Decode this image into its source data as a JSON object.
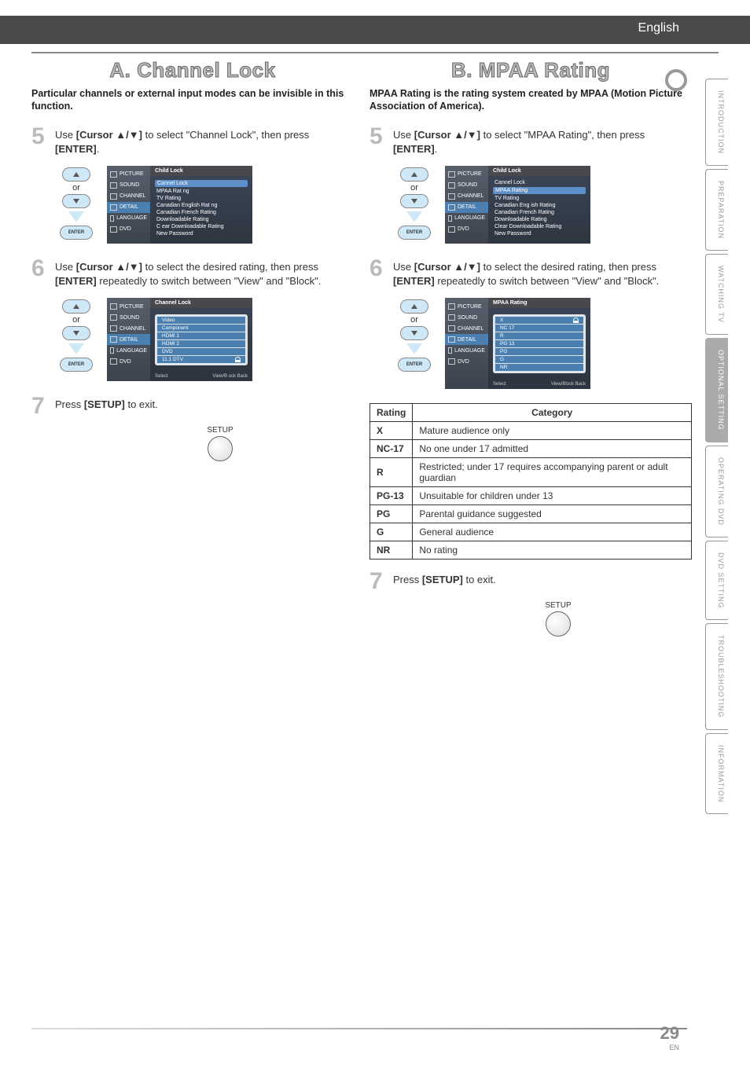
{
  "header": {
    "language": "English"
  },
  "side_tabs": [
    "INTRODUCTION",
    "PREPARATION",
    "WATCHING TV",
    "OPTIONAL SETTING",
    "OPERATING DVD",
    "DVD SETTING",
    "TROUBLESHOOTING",
    "INFORMATION"
  ],
  "side_tabs_active": 3,
  "page": {
    "number": "29",
    "en": "EN"
  },
  "left": {
    "title": "A.   Channel Lock",
    "subtitle": "Particular channels or external input modes can be invisible in this function.",
    "step5": {
      "num": "5",
      "text_a": "Use ",
      "cursor": "[Cursor ▲/▼]",
      "text_b": " to select \"Channel Lock\", then press ",
      "enter": "[ENTER]",
      "text_c": "."
    },
    "step6": {
      "num": "6",
      "text_a": "Use ",
      "cursor": "[Cursor ▲/▼]",
      "text_b": " to select the desired rating, then press ",
      "enter": "[ENTER]",
      "text_c": " repeatedly to switch between \"View\" and \"Block\"."
    },
    "step7": {
      "num": "7",
      "text_a": "Press ",
      "setup": "[SETUP]",
      "text_b": " to exit."
    },
    "remote": {
      "or": "or",
      "enter": "ENTER",
      "setup": "SETUP"
    },
    "osd1": {
      "title": "Child Lock",
      "side": [
        "PICTURE",
        "SOUND",
        "CHANNEL",
        "DETAIL",
        "LANGUAGE",
        "DVD"
      ],
      "items": [
        "Cannel Lock",
        "MPAA Rat ng",
        "TV Rating",
        "Canadian English Rat ng",
        "Canadian French Rating",
        "Downloadable Rating",
        "C ear Downloadable Rating",
        "New Password"
      ],
      "sel": 0
    },
    "osd2": {
      "title": "Channel Lock",
      "side": [
        "PICTURE",
        "SOUND",
        "CHANNEL",
        "DETAIL",
        "LANGUAGE",
        "DVD"
      ],
      "inner": [
        "Video",
        "Component",
        "HDMI 1",
        "HDMI 2",
        "DVD",
        "11.1 DTV"
      ],
      "footer_l": "Select",
      "footer_r": "View/B ock     Back"
    }
  },
  "right": {
    "title": "B. MPAA Rating",
    "subtitle": "MPAA Rating is the rating system created by MPAA (Motion Picture Association of America).",
    "step5": {
      "num": "5",
      "text_a": "Use ",
      "cursor": "[Cursor ▲/▼]",
      "text_b": " to select \"MPAA Rating\", then press ",
      "enter": "[ENTER]",
      "text_c": "."
    },
    "step6": {
      "num": "6",
      "text_a": "Use ",
      "cursor": "[Cursor ▲/▼]",
      "text_b": " to select the desired rating, then press ",
      "enter": "[ENTER]",
      "text_c": " repeatedly to switch between \"View\" and \"Block\"."
    },
    "step7": {
      "num": "7",
      "text_a": "Press ",
      "setup": "[SETUP]",
      "text_b": " to exit."
    },
    "remote": {
      "or": "or",
      "enter": "ENTER",
      "setup": "SETUP"
    },
    "osd1": {
      "title": "Child Lock",
      "side": [
        "PICTURE",
        "SOUND",
        "CHANNEL",
        "DETAIL",
        "LANGUAGE",
        "DVD"
      ],
      "items": [
        "Cannel Lock",
        "MPAA Rating",
        "TV Rating",
        "Canadian Eng ish Rating",
        "Canadian French Rating",
        "Downloadable Rating",
        "Clear Downloadable Rating",
        "New Password"
      ],
      "sel": 1
    },
    "osd2": {
      "title": "MPAA Rating",
      "side": [
        "PICTURE",
        "SOUND",
        "CHANNEL",
        "DETAIL",
        "LANGUAGE",
        "DVD"
      ],
      "inner": [
        "X",
        "NC 17",
        "R",
        "PG 13",
        "PG",
        "G",
        "NR"
      ],
      "footer_l": "Select",
      "footer_r": "View/Block     Back"
    },
    "table": {
      "h1": "Rating",
      "h2": "Category",
      "rows": [
        {
          "r": "X",
          "c": "Mature audience only"
        },
        {
          "r": "NC-17",
          "c": "No one under 17 admitted"
        },
        {
          "r": "R",
          "c": "Restricted; under 17 requires accompanying parent or adult guardian"
        },
        {
          "r": "PG-13",
          "c": "Unsuitable for children under 13"
        },
        {
          "r": "PG",
          "c": "Parental guidance suggested"
        },
        {
          "r": "G",
          "c": "General audience"
        },
        {
          "r": "NR",
          "c": "No rating"
        }
      ]
    }
  }
}
